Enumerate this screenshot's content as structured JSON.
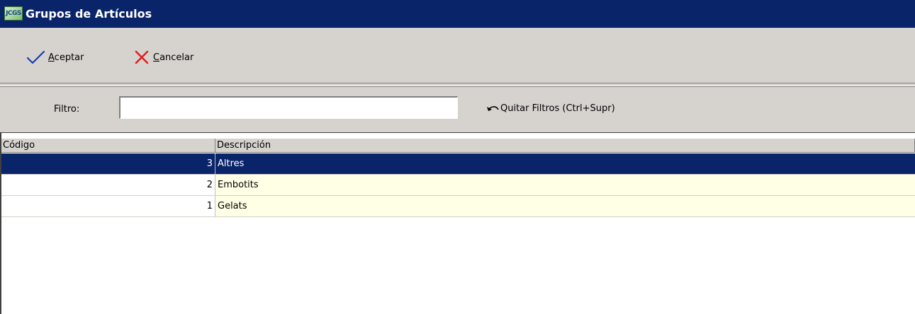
{
  "window": {
    "title": "Grupos de Artículos",
    "icon": "jcgs-app-icon",
    "icon_text": "JCGS"
  },
  "toolbar": {
    "accept": {
      "hotkey": "A",
      "rest": "ceptar",
      "icon": "checkmark-icon",
      "icon_color": "#1a3cb0"
    },
    "cancel": {
      "hotkey": "C",
      "rest": "ancelar",
      "icon": "x-mark-icon",
      "icon_color": "#e02020"
    }
  },
  "filter": {
    "label": "Filtro:",
    "value": "",
    "placeholder": "",
    "clear_label": "Quitar Filtros (Ctrl+Supr)",
    "clear_icon": "undo-arrow-icon"
  },
  "grid": {
    "columns": [
      "Código",
      "Descripción"
    ],
    "rows": [
      {
        "codigo": "3",
        "descripcion": "Altres",
        "selected": true
      },
      {
        "codigo": "2",
        "descripcion": "Embotits",
        "selected": false
      },
      {
        "codigo": "1",
        "descripcion": "Gelats",
        "selected": false
      }
    ]
  },
  "colors": {
    "titlebar": "#0a246a",
    "selection": "#0a246a",
    "row_alt_bg": "#ffffe6",
    "panel": "#d6d3ce"
  }
}
